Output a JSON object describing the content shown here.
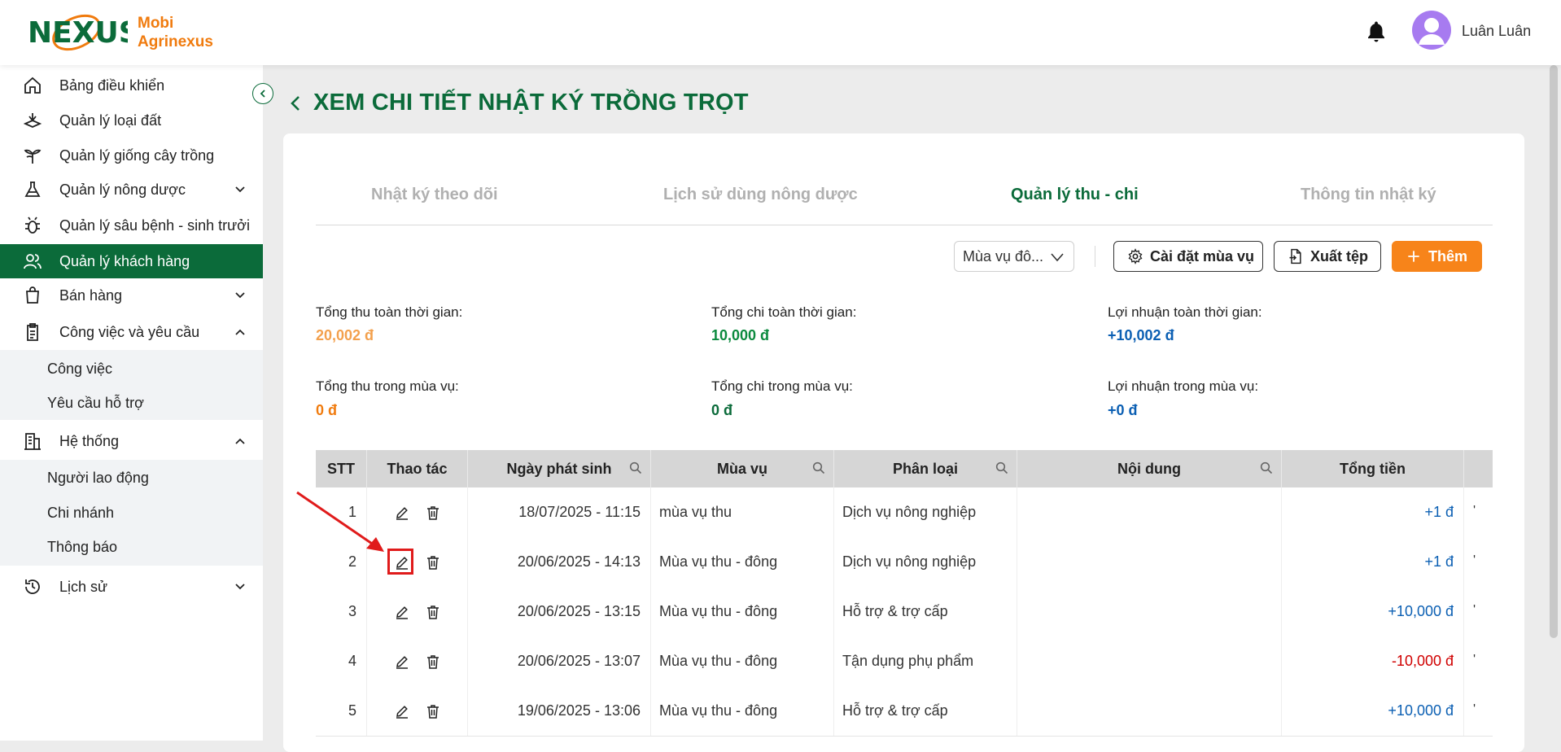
{
  "brand": {
    "logo_text": "NEXUS",
    "line1": "Mobi",
    "line2": "Agrinexus"
  },
  "header": {
    "username": "Luân Luân"
  },
  "sidebar": {
    "items": [
      {
        "label": "Bảng điều khiển",
        "icon": "home-icon"
      },
      {
        "label": "Quản lý loại đất",
        "icon": "land-icon"
      },
      {
        "label": "Quản lý giống cây trồng",
        "icon": "plant-icon"
      },
      {
        "label": "Quản lý nông dược",
        "icon": "flask-icon"
      },
      {
        "label": "Quản lý sâu bệnh - sinh trưởi",
        "icon": "bug-icon"
      },
      {
        "label": "Quản lý khách hàng",
        "icon": "users-icon"
      },
      {
        "label": "Bán hàng",
        "icon": "bag-icon"
      },
      {
        "label": "Công việc và yêu cầu",
        "icon": "clipboard-icon"
      },
      {
        "label": "Hệ thống",
        "icon": "building-icon"
      },
      {
        "label": "Lịch sử",
        "icon": "history-icon"
      }
    ],
    "sub_work": [
      "Công việc",
      "Yêu cầu hỗ trợ"
    ],
    "sub_system": [
      "Người lao động",
      "Chi nhánh",
      "Thông báo"
    ]
  },
  "page": {
    "title": "XEM CHI TIẾT NHẬT KÝ TRỒNG TRỌT"
  },
  "tabs": [
    "Nhật ký theo dõi",
    "Lịch sử dùng nông dược",
    "Quản lý thu - chi",
    "Thông tin nhật ký"
  ],
  "toolbar": {
    "season_select": "Mùa vụ đô...",
    "settings_label": "Cài đặt mùa vụ",
    "export_label": "Xuất tệp",
    "add_label": "Thêm"
  },
  "stats": {
    "total_income_label": "Tổng thu toàn thời gian:",
    "total_income": "20,002 đ",
    "total_expense_label": "Tổng chi toàn thời gian:",
    "total_expense": "10,000 đ",
    "total_profit_label": "Lợi nhuận toàn thời gian:",
    "total_profit": "+10,002 đ",
    "season_income_label": "Tổng thu trong mùa vụ:",
    "season_income": "0 đ",
    "season_expense_label": "Tổng chi trong mùa vụ:",
    "season_expense": "0 đ",
    "season_profit_label": "Lợi nhuận trong mùa vụ:",
    "season_profit": "+0 đ"
  },
  "table": {
    "columns": [
      "STT",
      "Thao tác",
      "Ngày phát sinh",
      "Mùa vụ",
      "Phân loại",
      "Nội dung",
      "Tổng tiền"
    ],
    "rows": [
      {
        "stt": "1",
        "date": "18/07/2025 - 11:15",
        "season": "mùa vụ thu",
        "category": "Dịch vụ nông nghiệp",
        "content": "",
        "amount": "+1 đ"
      },
      {
        "stt": "2",
        "date": "20/06/2025 - 14:13",
        "season": "Mùa vụ thu - đông",
        "category": "Dịch vụ nông nghiệp",
        "content": "",
        "amount": "+1 đ"
      },
      {
        "stt": "3",
        "date": "20/06/2025 - 13:15",
        "season": "Mùa vụ thu - đông",
        "category": "Hỗ trợ & trợ cấp",
        "content": "",
        "amount": "+10,000 đ"
      },
      {
        "stt": "4",
        "date": "20/06/2025 - 13:07",
        "season": "Mùa vụ thu - đông",
        "category": "Tận dụng phụ phẩm",
        "content": "",
        "amount": "-10,000 đ"
      },
      {
        "stt": "5",
        "date": "19/06/2025 - 13:06",
        "season": "Mùa vụ thu - đông",
        "category": "Hỗ trợ & trợ cấp",
        "content": "",
        "amount": "+10,000 đ"
      }
    ]
  },
  "colors": {
    "primary_green": "#0b6b3a",
    "accent_orange": "#f7841a",
    "profit_blue": "#0b5fb3",
    "negative_red": "#d00000"
  }
}
